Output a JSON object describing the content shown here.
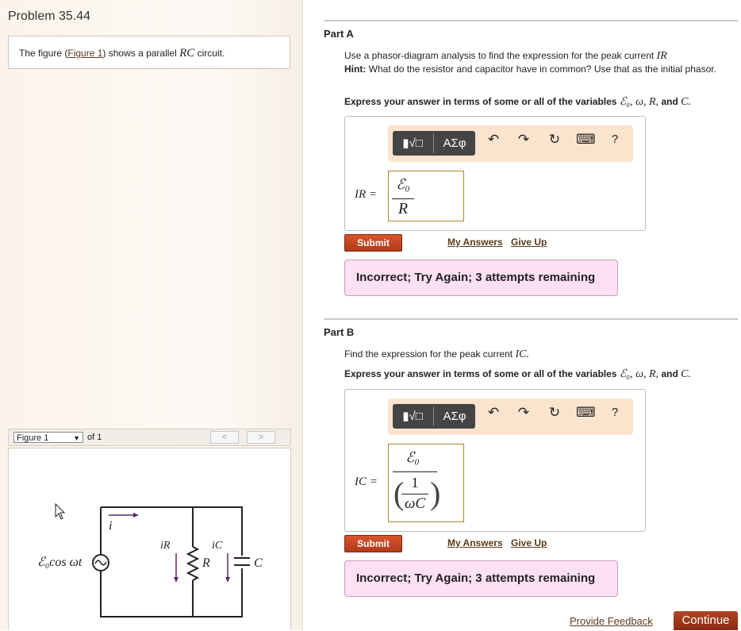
{
  "problem": {
    "title": "Problem 35.44",
    "intro_prefix": "The figure (",
    "intro_link": "Figure 1",
    "intro_middle": ") shows a parallel ",
    "intro_rc": "RC",
    "intro_suffix": " circuit."
  },
  "figure": {
    "selector_value": "Figure 1",
    "of_label": "of 1",
    "prev_label": "<",
    "next_label": ">",
    "labels": {
      "source": "ℰ₀cos ωt",
      "i": "i",
      "iR": "iR",
      "iC": "iC",
      "R": "R",
      "C": "C"
    }
  },
  "toolbar": {
    "template_icon": "▮√□",
    "greek_label": "ΑΣφ",
    "undo_icon": "↶",
    "redo_icon": "↷",
    "reset_icon": "↻",
    "keyboard_icon": "⌨",
    "help_label": "?"
  },
  "partA": {
    "label": "Part A",
    "question": "Use a phasor-diagram analysis to find the expression for the peak current",
    "question_var": "IR",
    "hint_label": "Hint:",
    "hint_text": "What do the resistor and capacitor have in common? Use that as the initial phasor.",
    "express_prefix": "Express your answer in terms of some or all of the variables",
    "express_vars": "ℰ₀, ω, R,",
    "express_and": "and",
    "express_last": "C.",
    "answer_label": "IR =",
    "answer_numerator": "ℰ₀",
    "answer_denominator": "R",
    "submit_label": "Submit",
    "my_answers_label": "My Answers",
    "give_up_label": "Give Up",
    "feedback": "Incorrect; Try Again; 3 attempts remaining"
  },
  "partB": {
    "label": "Part B",
    "question": "Find the expression for the peak current",
    "question_var": "IC.",
    "express_prefix": "Express your answer in terms of some or all of the variables",
    "express_vars": "ℰ₀, ω, R,",
    "express_and": "and",
    "express_last": "C.",
    "answer_label": "IC =",
    "answer_numerator": "ℰ₀",
    "answer_inner_num": "1",
    "answer_inner_den": "ωC",
    "submit_label": "Submit",
    "my_answers_label": "My Answers",
    "give_up_label": "Give Up",
    "feedback": "Incorrect; Try Again; 3 attempts remaining"
  },
  "footer": {
    "feedback_link": "Provide Feedback",
    "continue_label": "Continue"
  }
}
